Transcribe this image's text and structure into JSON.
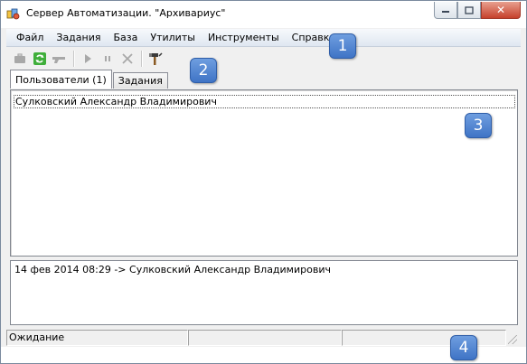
{
  "window": {
    "title": "Сервер Автоматизации. \"Архивариус\"",
    "controls": {
      "minimize": "▁",
      "maximize": "□",
      "close": "✕"
    }
  },
  "menu": {
    "items": [
      "Файл",
      "Задания",
      "База",
      "Утилиты",
      "Инструменты",
      "Справка"
    ]
  },
  "toolbar": {
    "buttons": [
      "briefcase-icon",
      "refresh-icon",
      "gun-icon",
      "play-icon",
      "pause-icon",
      "stop-icon",
      "hammer-icon"
    ]
  },
  "tabs": [
    {
      "label": "Пользователи (1)",
      "active": true
    },
    {
      "label": "Задания",
      "active": false
    }
  ],
  "users": {
    "rows": [
      "Сулковский Александр Владимирович"
    ]
  },
  "log": {
    "lines": [
      "14 фев 2014 08:29 -> Сулковский Александр Владимирович"
    ]
  },
  "status": {
    "text": "Ожидание",
    "cell2": "",
    "cell3": ""
  },
  "callouts": [
    "1",
    "2",
    "3",
    "4"
  ],
  "colors": {
    "callout": "#4a7fd0",
    "menubar": "#e6ecf5",
    "close_button": "#c6412c"
  }
}
